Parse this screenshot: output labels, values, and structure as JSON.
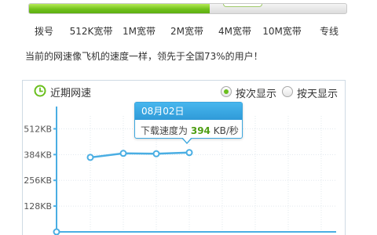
{
  "progress": {
    "fraction": 0.57
  },
  "scale_labels": [
    "拨号",
    "512K宽带",
    "1M宽带",
    "2M宽带",
    "4M宽带",
    "10M宽带",
    "专线"
  ],
  "summary_text": "当前的网速像飞机的速度一样，领先于全国73%的用户！",
  "panel": {
    "title": "近期网速",
    "radio_by_count": "按次显示",
    "radio_by_day": "按天显示",
    "selected_mode": "by_count"
  },
  "tooltip": {
    "date": "08月02日",
    "prefix": "下载速度为",
    "value": "394",
    "unit": "KB/秒"
  },
  "colors": {
    "accent_green": "#72c21c",
    "line_blue": "#4aaee3",
    "tooltip_blue": "#2f9ad8"
  },
  "icons": [
    "clock-icon",
    "radio-icon"
  ],
  "chart_data": {
    "type": "line",
    "title": "近期网速",
    "y_ticks": [
      "512KB",
      "384KB",
      "256KB",
      "128KB"
    ],
    "ylim": [
      0,
      576
    ],
    "grid": true,
    "series": [
      {
        "x_index": [
          0,
          1,
          2,
          3
        ],
        "values": [
          370,
          390,
          388,
          394
        ]
      }
    ],
    "origin_value": 0
  }
}
